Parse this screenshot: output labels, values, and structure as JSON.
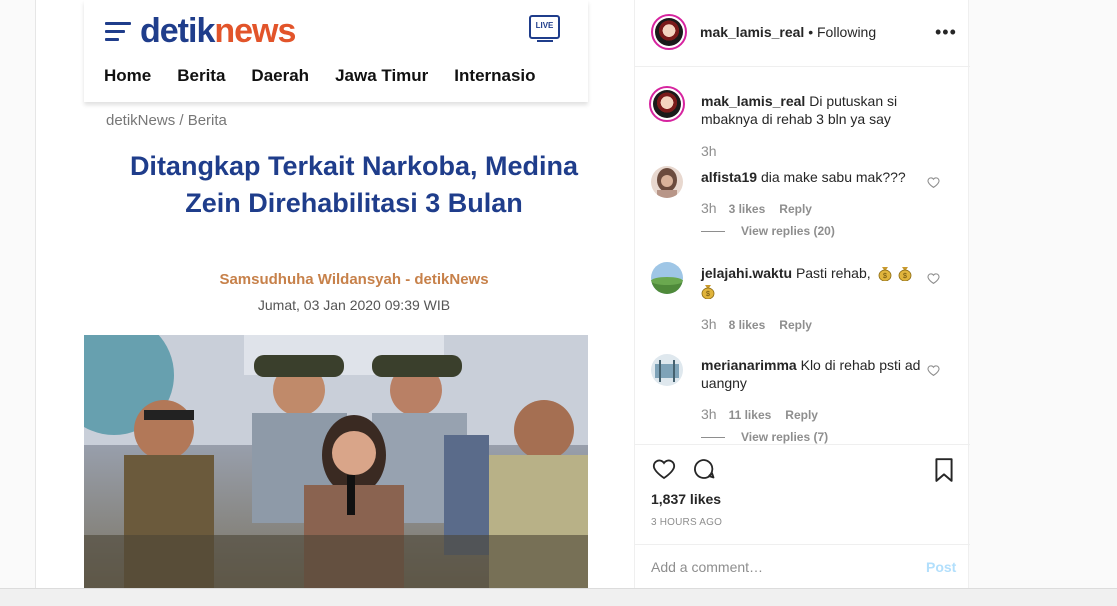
{
  "article": {
    "logo_part1": "detik",
    "logo_part2": "news",
    "live_label": "LIVE",
    "nav": [
      "Home",
      "Berita",
      "Daerah",
      "Jawa Timur",
      "Internasio"
    ],
    "breadcrumb": "detikNews / Berita",
    "headline": "Ditangkap Terkait Narkoba, Medina Zein Direhabilitasi 3 Bulan",
    "author": "Samsudhuha Wildansyah - detikNews",
    "date": "Jumat, 03 Jan 2020 09:39 WIB"
  },
  "post": {
    "username": "mak_lamis_real",
    "follow_status": "• Following",
    "caption_user": "mak_lamis_real",
    "caption_text": "Di putuskan si mbaknya di rehab 3 bln ya say",
    "caption_time": "3h",
    "comments": [
      {
        "user": "alfista19",
        "text": "dia make sabu mak???",
        "time": "3h",
        "likes": "3 likes",
        "reply": "Reply",
        "view_replies": "View replies (20)"
      },
      {
        "user": "jelajahi.waktu",
        "text": "Pasti rehab,",
        "time": "3h",
        "likes": "8 likes",
        "reply": "Reply"
      },
      {
        "user": "merianarimma",
        "text": "Klo di rehab psti ad uangny",
        "time": "3h",
        "likes": "11 likes",
        "reply": "Reply",
        "view_replies": "View replies (7)"
      }
    ],
    "likes_count": "1,837 likes",
    "posted_ago": "3 HOURS AGO",
    "add_comment_placeholder": "Add a comment…",
    "post_button": "Post"
  },
  "icons": {
    "more": "more-options-icon",
    "heart": "heart-icon",
    "comment": "comment-icon",
    "bookmark": "bookmark-icon",
    "emoji": "money-bag-emoji"
  }
}
